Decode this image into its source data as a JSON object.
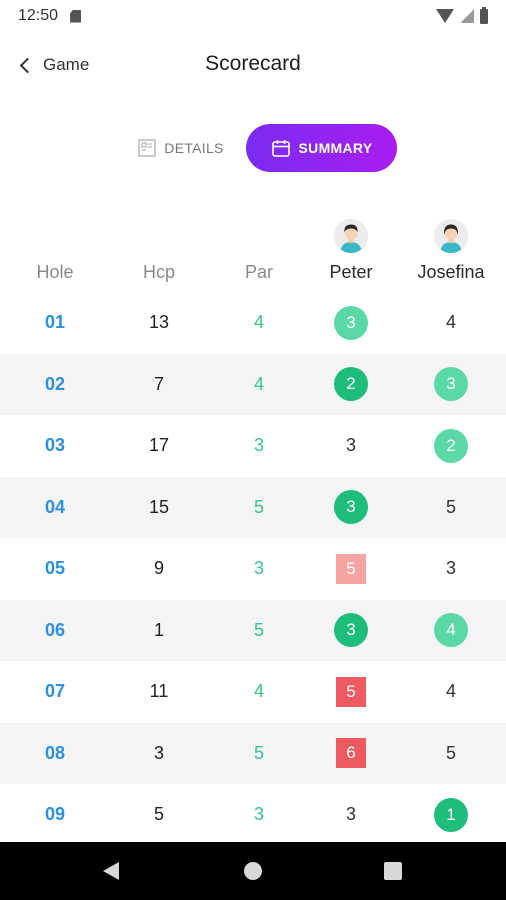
{
  "status_bar": {
    "time": "12:50",
    "icons": [
      "sd-card-icon",
      "wifi-icon",
      "signal-icon",
      "battery-icon"
    ]
  },
  "header": {
    "back_label": "Game",
    "title": "Scorecard"
  },
  "tabs": {
    "details": {
      "label": "DETAILS",
      "icon": "details-icon",
      "active": false
    },
    "summary": {
      "label": "SUMMARY",
      "icon": "calendar-icon",
      "active": true
    }
  },
  "colors": {
    "accent_gradient_start": "#7a2cf2",
    "accent_gradient_end": "#a91df0",
    "hole_blue": "#2b8fe3",
    "par_green": "#3cc28e",
    "birdie_light_green": "#5ad8a6",
    "eagle_dark_green": "#1fbd7b",
    "bogey_light_red": "#f6a3a4",
    "double_bogey_red": "#ee5a5f"
  },
  "table": {
    "columns": [
      "Hole",
      "Hcp",
      "Par",
      "Peter",
      "Josefina"
    ],
    "players": [
      {
        "name": "Peter",
        "avatar": "avatar-icon"
      },
      {
        "name": "Josefina",
        "avatar": "avatar-icon"
      }
    ],
    "rows": [
      {
        "hole": "01",
        "hcp": "13",
        "par": "4",
        "p1": "3",
        "p1_style": "circle b-light-green",
        "p2": "4",
        "p2_style": ""
      },
      {
        "hole": "02",
        "hcp": "7",
        "par": "4",
        "p1": "2",
        "p1_style": "circle b-dark-green",
        "p2": "3",
        "p2_style": "circle b-light-green"
      },
      {
        "hole": "03",
        "hcp": "17",
        "par": "3",
        "p1": "3",
        "p1_style": "",
        "p2": "2",
        "p2_style": "circle b-light-green"
      },
      {
        "hole": "04",
        "hcp": "15",
        "par": "5",
        "p1": "3",
        "p1_style": "circle b-dark-green",
        "p2": "5",
        "p2_style": ""
      },
      {
        "hole": "05",
        "hcp": "9",
        "par": "3",
        "p1": "5",
        "p1_style": "square b-light-red",
        "p2": "3",
        "p2_style": ""
      },
      {
        "hole": "06",
        "hcp": "1",
        "par": "5",
        "p1": "3",
        "p1_style": "circle b-dark-green",
        "p2": "4",
        "p2_style": "circle b-light-green"
      },
      {
        "hole": "07",
        "hcp": "11",
        "par": "4",
        "p1": "5",
        "p1_style": "square b-red",
        "p2": "4",
        "p2_style": ""
      },
      {
        "hole": "08",
        "hcp": "3",
        "par": "5",
        "p1": "6",
        "p1_style": "square b-red",
        "p2": "5",
        "p2_style": ""
      },
      {
        "hole": "09",
        "hcp": "5",
        "par": "3",
        "p1": "3",
        "p1_style": "",
        "p2": "1",
        "p2_style": "circle b-dark-green"
      }
    ]
  },
  "nav_bar": {
    "icons": [
      "nav-back-icon",
      "nav-home-icon",
      "nav-recents-icon"
    ]
  }
}
